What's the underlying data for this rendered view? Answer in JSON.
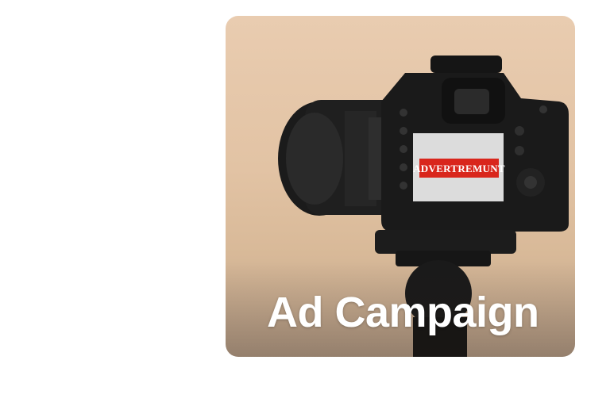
{
  "card": {
    "title": "Ad Campaign",
    "screen_text": "ADVERTREMUNT",
    "accent_red": "#d9261c"
  }
}
